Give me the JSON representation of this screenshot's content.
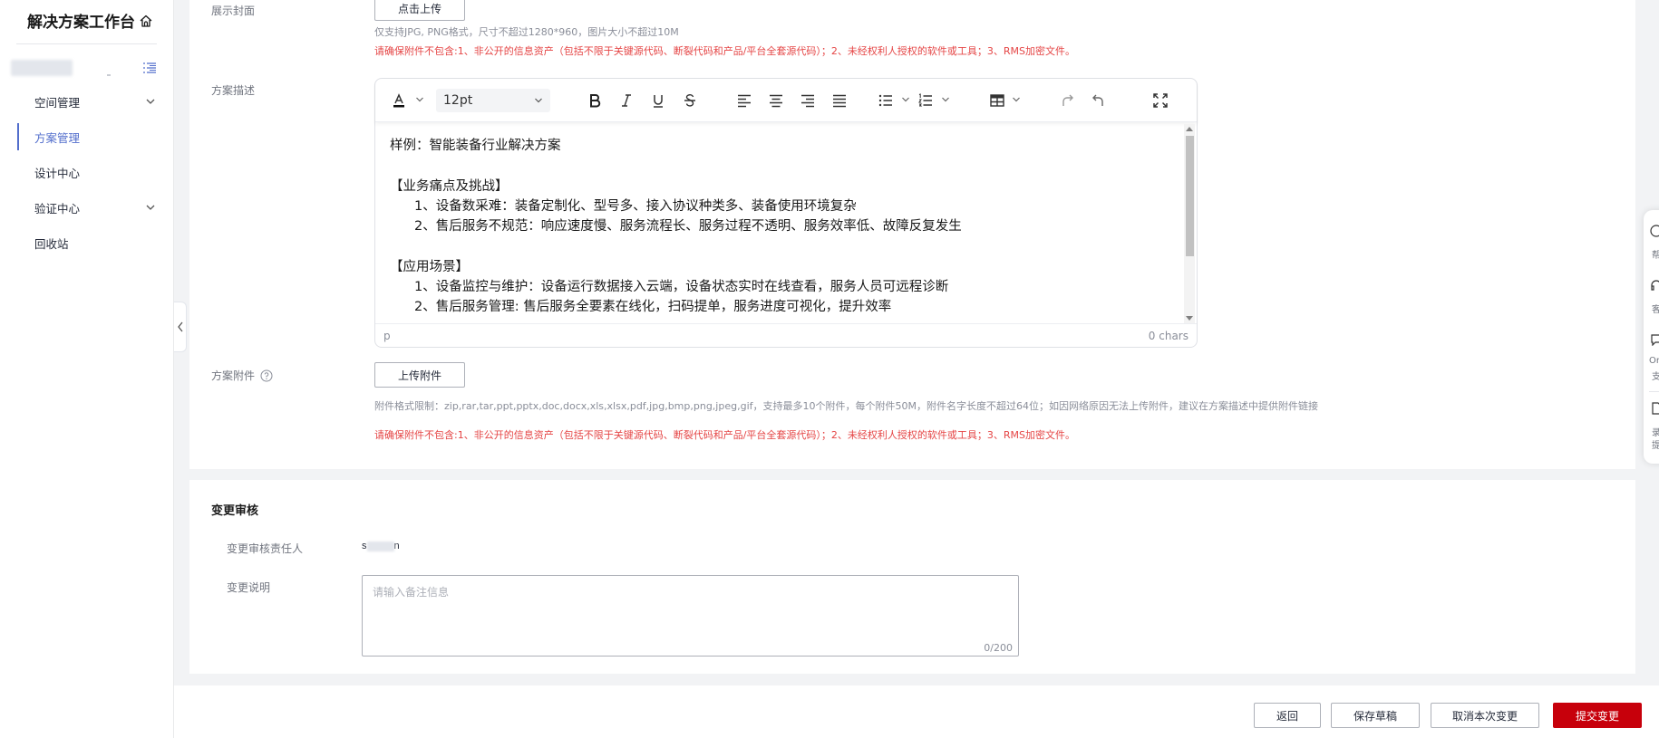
{
  "sidebar": {
    "app_title": "解决方案工作台",
    "nav": [
      {
        "label": "空间管理",
        "has_children": true
      },
      {
        "label": "方案管理",
        "active": true
      },
      {
        "label": "设计中心"
      },
      {
        "label": "验证中心",
        "has_children": true
      },
      {
        "label": "回收站"
      }
    ]
  },
  "cover": {
    "label": "展示封面",
    "upload_button": "点击上传",
    "hint": "仅支持JPG, PNG格式，尺寸不超过1280*960，图片大小不超过10M",
    "warning": "请确保附件不包含:1、非公开的信息资产（包括不限于关键源代码、断裂代码和产品/平台全套源代码）；2、未经权利人授权的软件或工具；3、RMS加密文件。"
  },
  "description": {
    "label": "方案描述",
    "font_size": "12pt",
    "content": {
      "example": "样例：智能装备行业解决方案",
      "section1_title": "【业务痛点及挑战】",
      "section1_items": [
        "1、设备数采难：装备定制化、型号多、接入协议种类多、装备使用环境复杂",
        "2、售后服务不规范：响应速度慢、服务流程长、服务过程不透明、服务效率低、故障反复发生"
      ],
      "section2_title": "【应用场景】",
      "section2_items": [
        "1、设备监控与维护：设备运行数据接入云端，设备状态实时在线查看，服务人员可远程诊断",
        "2、售后服务管理: 售后服务全要素在线化，扫码提单，服务进度可视化，提升效率"
      ]
    },
    "status_path": "p",
    "char_count": "0 chars"
  },
  "attachment": {
    "label": "方案附件",
    "upload_button": "上传附件",
    "hint": "附件格式限制：zip,rar,tar,ppt,pptx,doc,docx,xls,xlsx,pdf,jpg,bmp,png,jpeg,gif，支持最多10个附件，每个附件50M，附件名字长度不超过64位；如因网络原因无法上传附件，建议在方案描述中提供附件链接",
    "warning": "请确保附件不包含:1、非公开的信息资产（包括不限于关键源代码、断裂代码和产品/平台全套源代码）；2、未经权利人授权的软件或工具；3、RMS加密文件。"
  },
  "review": {
    "title": "变更审核",
    "reviewer_label": "变更审核责任人",
    "reviewer_value_start": "s",
    "reviewer_value_end": "n",
    "remark_label": "变更说明",
    "remark_placeholder": "请输入备注信息",
    "remark_count": "0/200"
  },
  "footer": {
    "back": "返回",
    "save_draft": "保存草稿",
    "cancel_change": "取消本次变更",
    "submit_change": "提交变更"
  },
  "float_panel": {
    "items": [
      "帮",
      "客",
      "On",
      "支",
      "录",
      "提"
    ]
  },
  "colors": {
    "primary_red": "#c7000b",
    "active_blue": "#526ecc",
    "warning_red": "#e54545"
  }
}
